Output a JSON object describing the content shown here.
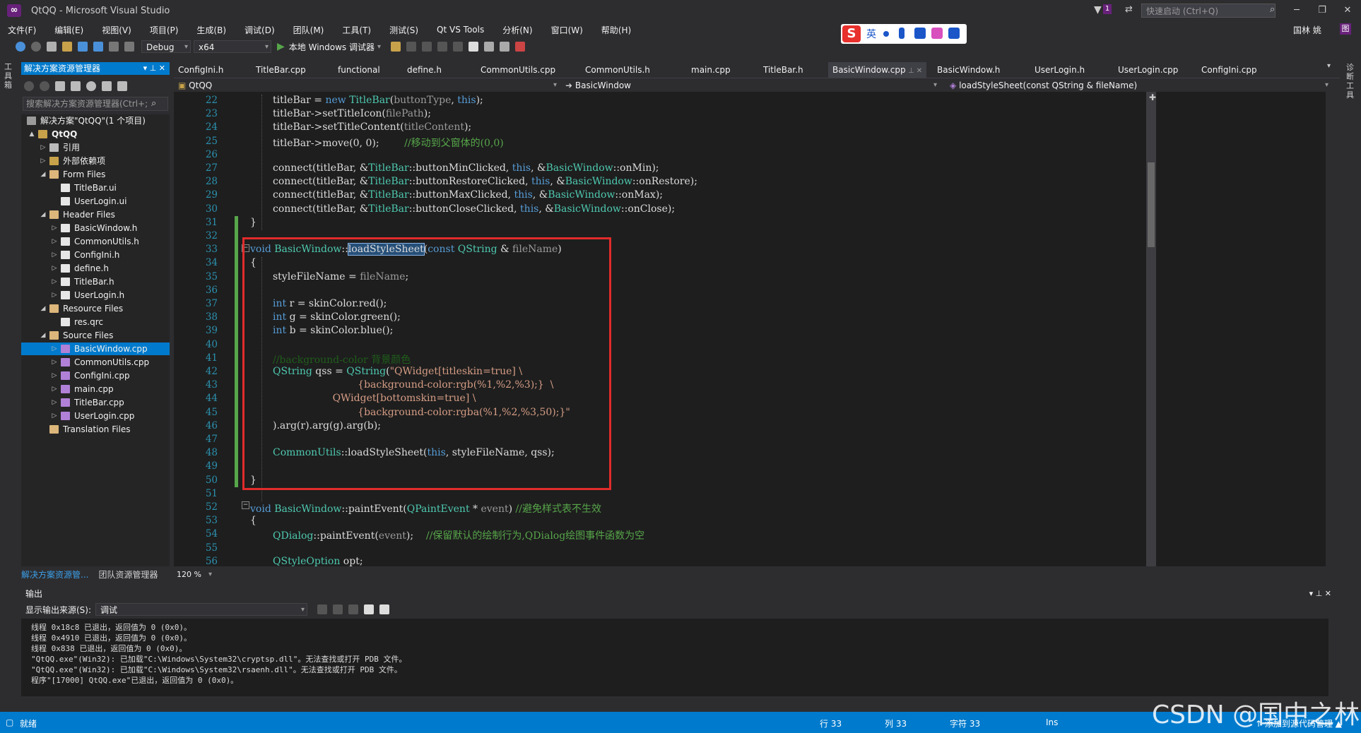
{
  "window": {
    "title": "QtQQ - Microsoft Visual Studio",
    "quick_launch": "快速启动 (Ctrl+Q)",
    "notify_count": "1",
    "user_name": "国林 姚",
    "user_badge": "图"
  },
  "menu": [
    "文件(F)",
    "编辑(E)",
    "视图(V)",
    "项目(P)",
    "生成(B)",
    "调试(D)",
    "团队(M)",
    "工具(T)",
    "测试(S)",
    "Qt VS Tools",
    "分析(N)",
    "窗口(W)",
    "帮助(H)"
  ],
  "ime": {
    "logo": "S",
    "lang": "英"
  },
  "toolbar": {
    "config": "Debug",
    "platform": "x64",
    "run_label": "本地 Windows 调试器"
  },
  "left_strip": {
    "toolbox": "工具箱"
  },
  "right_strip": {
    "label": "诊断工具"
  },
  "solution_explorer": {
    "title": "解决方案资源管理器",
    "search_placeholder": "搜索解决方案资源管理器(Ctrl+;",
    "tree": [
      {
        "label": "解决方案\"QtQQ\"(1 个项目)",
        "depth": 0,
        "expander": "",
        "icon": "solution-icon",
        "selected": false
      },
      {
        "label": "QtQQ",
        "depth": 1,
        "expander": "▲",
        "icon": "project-icon",
        "selected": false
      },
      {
        "label": "引用",
        "depth": 2,
        "expander": "▷",
        "icon": "references-icon",
        "selected": false
      },
      {
        "label": "外部依赖项",
        "depth": 2,
        "expander": "▷",
        "icon": "external-deps-icon",
        "selected": false
      },
      {
        "label": "Form Files",
        "depth": 2,
        "expander": "◢",
        "icon": "folder-icon",
        "selected": false
      },
      {
        "label": "TitleBar.ui",
        "depth": 3,
        "expander": "",
        "icon": "ui-file-icon",
        "selected": false
      },
      {
        "label": "UserLogin.ui",
        "depth": 3,
        "expander": "",
        "icon": "ui-file-icon",
        "selected": false
      },
      {
        "label": "Header Files",
        "depth": 2,
        "expander": "◢",
        "icon": "folder-icon",
        "selected": false
      },
      {
        "label": "BasicWindow.h",
        "depth": 3,
        "expander": "▷",
        "icon": "header-file-icon",
        "selected": false
      },
      {
        "label": "CommonUtils.h",
        "depth": 3,
        "expander": "▷",
        "icon": "header-file-icon",
        "selected": false
      },
      {
        "label": "ConfigIni.h",
        "depth": 3,
        "expander": "▷",
        "icon": "header-file-icon",
        "selected": false
      },
      {
        "label": "define.h",
        "depth": 3,
        "expander": "▷",
        "icon": "header-file-icon",
        "selected": false
      },
      {
        "label": "TitleBar.h",
        "depth": 3,
        "expander": "▷",
        "icon": "header-file-icon",
        "selected": false
      },
      {
        "label": "UserLogin.h",
        "depth": 3,
        "expander": "▷",
        "icon": "header-file-icon",
        "selected": false
      },
      {
        "label": "Resource Files",
        "depth": 2,
        "expander": "◢",
        "icon": "folder-icon",
        "selected": false
      },
      {
        "label": "res.qrc",
        "depth": 3,
        "expander": "",
        "icon": "resource-file-icon",
        "selected": false
      },
      {
        "label": "Source Files",
        "depth": 2,
        "expander": "◢",
        "icon": "folder-icon",
        "selected": false
      },
      {
        "label": "BasicWindow.cpp",
        "depth": 3,
        "expander": "▷",
        "icon": "cpp-file-icon",
        "selected": true
      },
      {
        "label": "CommonUtils.cpp",
        "depth": 3,
        "expander": "▷",
        "icon": "cpp-file-icon",
        "selected": false
      },
      {
        "label": "ConfigIni.cpp",
        "depth": 3,
        "expander": "▷",
        "icon": "cpp-file-icon",
        "selected": false
      },
      {
        "label": "main.cpp",
        "depth": 3,
        "expander": "▷",
        "icon": "cpp-file-icon",
        "selected": false
      },
      {
        "label": "TitleBar.cpp",
        "depth": 3,
        "expander": "▷",
        "icon": "cpp-file-icon",
        "selected": false
      },
      {
        "label": "UserLogin.cpp",
        "depth": 3,
        "expander": "▷",
        "icon": "cpp-file-icon",
        "selected": false
      },
      {
        "label": "Translation Files",
        "depth": 2,
        "expander": "",
        "icon": "folder-icon",
        "selected": false
      }
    ],
    "bottom_tabs": [
      "解决方案资源管...",
      "团队资源管理器"
    ]
  },
  "editor_tabs": [
    {
      "label": "ConfigIni.h",
      "active": false
    },
    {
      "label": "TitleBar.cpp",
      "active": false
    },
    {
      "label": "functional",
      "active": false
    },
    {
      "label": "define.h",
      "active": false
    },
    {
      "label": "CommonUtils.cpp",
      "active": false
    },
    {
      "label": "CommonUtils.h",
      "active": false
    },
    {
      "label": "main.cpp",
      "active": false
    },
    {
      "label": "TitleBar.h",
      "active": false
    },
    {
      "label": "BasicWindow.cpp",
      "active": true
    },
    {
      "label": "BasicWindow.h",
      "active": false
    },
    {
      "label": "UserLogin.h",
      "active": false
    },
    {
      "label": "UserLogin.cpp",
      "active": false
    },
    {
      "label": "ConfigIni.cpp",
      "active": false
    }
  ],
  "navbar": {
    "project": "QtQQ",
    "scope": "BasicWindow",
    "member": "loadStyleSheet(const QString & fileName)"
  },
  "code_lines": [
    {
      "n": "22",
      "indent": 1,
      "html": "titleBar = <span style=\"color:#569cd6\">new</span> <span style=\"color:#4ec9b0\">TitleBar</span>(<span style=\"color:#9a9a9a\">buttonType</span>, <span style=\"color:#569cd6\">this</span>);"
    },
    {
      "n": "23",
      "indent": 1,
      "html": "titleBar-&gt;setTitleIcon(<span style=\"color:#9a9a9a\">filePath</span>);"
    },
    {
      "n": "24",
      "indent": 1,
      "html": "titleBar-&gt;setTitleContent(<span style=\"color:#9a9a9a\">titleContent</span>);"
    },
    {
      "n": "25",
      "indent": 1,
      "html": "titleBar-&gt;move(0, 0);        <span style=\"color:#57a64a\">//移动到父窗体的(0,0)</span>"
    },
    {
      "n": "26",
      "indent": 1,
      "html": ""
    },
    {
      "n": "27",
      "indent": 1,
      "html": "connect(titleBar, &amp;<span style=\"color:#4ec9b0\">TitleBar</span>::buttonMinClicked, <span style=\"color:#569cd6\">this</span>, &amp;<span style=\"color:#4ec9b0\">BasicWindow</span>::onMin);"
    },
    {
      "n": "28",
      "indent": 1,
      "html": "connect(titleBar, &amp;<span style=\"color:#4ec9b0\">TitleBar</span>::buttonRestoreClicked, <span style=\"color:#569cd6\">this</span>, &amp;<span style=\"color:#4ec9b0\">BasicWindow</span>::onRestore);"
    },
    {
      "n": "29",
      "indent": 1,
      "html": "connect(titleBar, &amp;<span style=\"color:#4ec9b0\">TitleBar</span>::buttonMaxClicked, <span style=\"color:#569cd6\">this</span>, &amp;<span style=\"color:#4ec9b0\">BasicWindow</span>::onMax);"
    },
    {
      "n": "30",
      "indent": 1,
      "html": "connect(titleBar, &amp;<span style=\"color:#4ec9b0\">TitleBar</span>::buttonCloseClicked, <span style=\"color:#569cd6\">this</span>, &amp;<span style=\"color:#4ec9b0\">BasicWindow</span>::onClose);"
    },
    {
      "n": "31",
      "indent": 0,
      "html": "}"
    },
    {
      "n": "32",
      "indent": 0,
      "html": ""
    },
    {
      "n": "33",
      "indent": 0,
      "html": "<span style=\"color:#569cd6\">void</span> <span style=\"color:#4ec9b0\">BasicWindow</span>::<span id=\"sel-word\">loadStyleSheet</span>(<span style=\"color:#569cd6\">const</span> <span style=\"color:#4ec9b0\">QString</span> &amp; <span style=\"color:#9a9a9a\">fileName</span>)"
    },
    {
      "n": "34",
      "indent": 0,
      "html": "{"
    },
    {
      "n": "35",
      "indent": 1,
      "html": "styleFileName = <span style=\"color:#9a9a9a\">fileName</span>;"
    },
    {
      "n": "36",
      "indent": 1,
      "html": ""
    },
    {
      "n": "37",
      "indent": 1,
      "html": "<span style=\"color:#569cd6\">int</span> r = skinColor.red();"
    },
    {
      "n": "38",
      "indent": 1,
      "html": "<span style=\"color:#569cd6\">int</span> g = skinColor.green();"
    },
    {
      "n": "39",
      "indent": 1,
      "html": "<span style=\"color:#569cd6\">int</span> b = skinColor.blue();"
    },
    {
      "n": "40",
      "indent": 1,
      "html": ""
    },
    {
      "n": "41",
      "indent": 1,
      "html": "<span style=\"color:#1f5e1b\">//background-color 背景颜色</span>"
    },
    {
      "n": "42",
      "indent": 1,
      "html": "<span style=\"color:#4ec9b0\">QString</span> qss = <span style=\"color:#4ec9b0\">QString</span>(<span style=\"color:#d69d85\">\"QWidget[titleskin=true] \\</span>"
    },
    {
      "n": "43",
      "indent": 1,
      "html": "                           <span style=\"color:#d69d85\">{background-color:rgb(%1,%2,%3);}  \\</span>"
    },
    {
      "n": "44",
      "indent": 1,
      "html": "                   <span style=\"color:#d69d85\">QWidget[bottomskin=true] \\</span>"
    },
    {
      "n": "45",
      "indent": 1,
      "html": "                           <span style=\"color:#d69d85\">{background-color:rgba(%1,%2,%3,50);}\"</span>"
    },
    {
      "n": "46",
      "indent": 1,
      "html": ").arg(r).arg(g).arg(b);"
    },
    {
      "n": "47",
      "indent": 1,
      "html": ""
    },
    {
      "n": "48",
      "indent": 1,
      "html": "<span style=\"color:#4ec9b0\">CommonUtils</span>::loadStyleSheet(<span style=\"color:#569cd6\">this</span>, styleFileName, qss);"
    },
    {
      "n": "49",
      "indent": 1,
      "html": ""
    },
    {
      "n": "50",
      "indent": 0,
      "html": "}"
    },
    {
      "n": "51",
      "indent": 0,
      "html": ""
    },
    {
      "n": "52",
      "indent": 0,
      "html": "<span style=\"color:#569cd6\">void</span> <span style=\"color:#4ec9b0\">BasicWindow</span>::paintEvent(<span style=\"color:#4ec9b0\">QPaintEvent</span> * <span style=\"color:#9a9a9a\">event</span>) <span style=\"color:#57a64a\">//避免样式表不生效</span>"
    },
    {
      "n": "53",
      "indent": 0,
      "html": "{"
    },
    {
      "n": "54",
      "indent": 1,
      "html": "<span style=\"color:#4ec9b0\">QDialog</span>::paintEvent(<span style=\"color:#9a9a9a\">event</span>);    <span style=\"color:#57a64a\">//保留默认的绘制行为,QDialog绘图事件函数为空</span>"
    },
    {
      "n": "55",
      "indent": 1,
      "html": ""
    },
    {
      "n": "56",
      "indent": 1,
      "html": "<span style=\"color:#4ec9b0\">QStyleOption</span> opt;"
    }
  ],
  "zoom": "120 %",
  "output": {
    "title": "输出",
    "source_label": "显示输出来源(S):",
    "source_value": "调试",
    "lines": [
      "线程 0x18c8 已退出，返回值为 0 (0x0)。",
      "线程 0x4910 已退出，返回值为 0 (0x0)。",
      "线程 0x838 已退出，返回值为 0 (0x0)。",
      "\"QtQQ.exe\"(Win32): 已加载\"C:\\Windows\\System32\\cryptsp.dll\"。无法查找或打开 PDB 文件。",
      "\"QtQQ.exe\"(Win32): 已加载\"C:\\Windows\\System32\\rsaenh.dll\"。无法查找或打开 PDB 文件。",
      "程序\"[17000] QtQQ.exe\"已退出，返回值为 0 (0x0)。"
    ]
  },
  "status": {
    "ready": "就绪",
    "line": "行 33",
    "col": "列 33",
    "char": "字符 33",
    "mode": "Ins",
    "source_control": "↑ 添加到源代码管理 ▲"
  },
  "watermark": "CSDN @国中之林",
  "colors": {
    "accent": "#007acc",
    "highlight_box": "#e12b2b",
    "change_bar": "#57a64a",
    "keyword": "#569cd6",
    "type": "#4ec9b0",
    "string": "#d69d85",
    "comment": "#57a64a"
  }
}
